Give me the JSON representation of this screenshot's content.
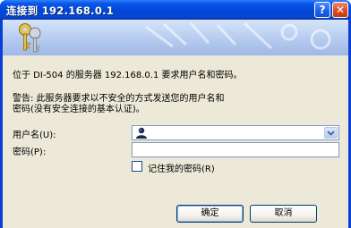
{
  "window": {
    "title": "连接到 192.168.0.1",
    "help_glyph": "?",
    "close_glyph": "✕"
  },
  "message": {
    "line1": "位于 DI-504 的服务器 192.168.0.1 要求用户名和密码。",
    "line2": "警告: 此服务器要求以不安全的方式发送您的用户名和",
    "line3": "密码(没有安全连接的基本认证)。"
  },
  "form": {
    "username_label": "用户名(U):",
    "username_value": "",
    "password_label": "密码(P):",
    "password_value": "",
    "remember_label": "记住我的密码(R)",
    "remember_checked": false
  },
  "buttons": {
    "ok": "确定",
    "cancel": "取消"
  },
  "icons": {
    "banner": "keys-icon",
    "user": "user-icon",
    "dropdown": "chevron-down-icon"
  },
  "colors": {
    "titlebar": "#0a56e8",
    "client_bg": "#ece9d8",
    "close_button": "#dd4a22"
  }
}
